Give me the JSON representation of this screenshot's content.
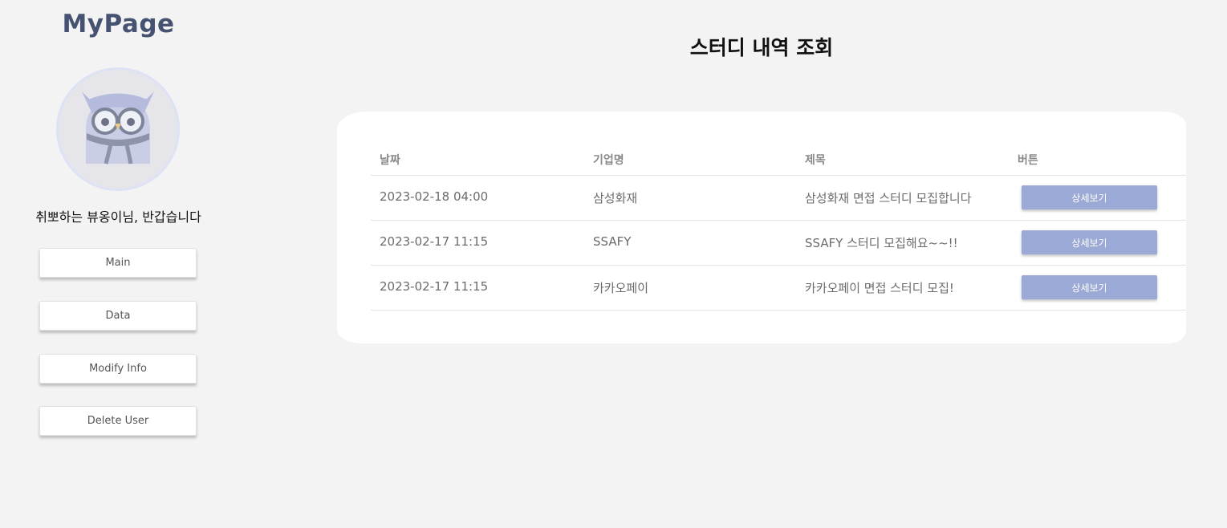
{
  "sidebar": {
    "logo": "MyPage",
    "avatar_icon": "owl-avatar-icon",
    "greeting": "취뽀하는 뷰옹이님, 반갑습니다",
    "menu": [
      {
        "label": "Main"
      },
      {
        "label": "Data"
      },
      {
        "label": "Modify Info"
      },
      {
        "label": "Delete User"
      }
    ]
  },
  "main": {
    "title": "스터디 내역 조회",
    "table": {
      "headers": [
        "날짜",
        "기업명",
        "제목",
        "버튼"
      ],
      "rows": [
        {
          "date": "2023-02-18 04:00",
          "company": "삼성화재",
          "title": "삼성화재 면접 스터디 모집합니다",
          "button": "상세보기"
        },
        {
          "date": "2023-02-17 11:15",
          "company": "SSAFY",
          "title": "SSAFY 스터디 모집해요~~!!",
          "button": "상세보기"
        },
        {
          "date": "2023-02-17 11:15",
          "company": "카카오페이",
          "title": "카카오페이 면접 스터디 모집!",
          "button": "상세보기"
        }
      ]
    }
  },
  "colors": {
    "background": "#f3f3f3",
    "logo": "#465272",
    "button_accent": "#9aa9d5",
    "card": "#ffffff"
  }
}
